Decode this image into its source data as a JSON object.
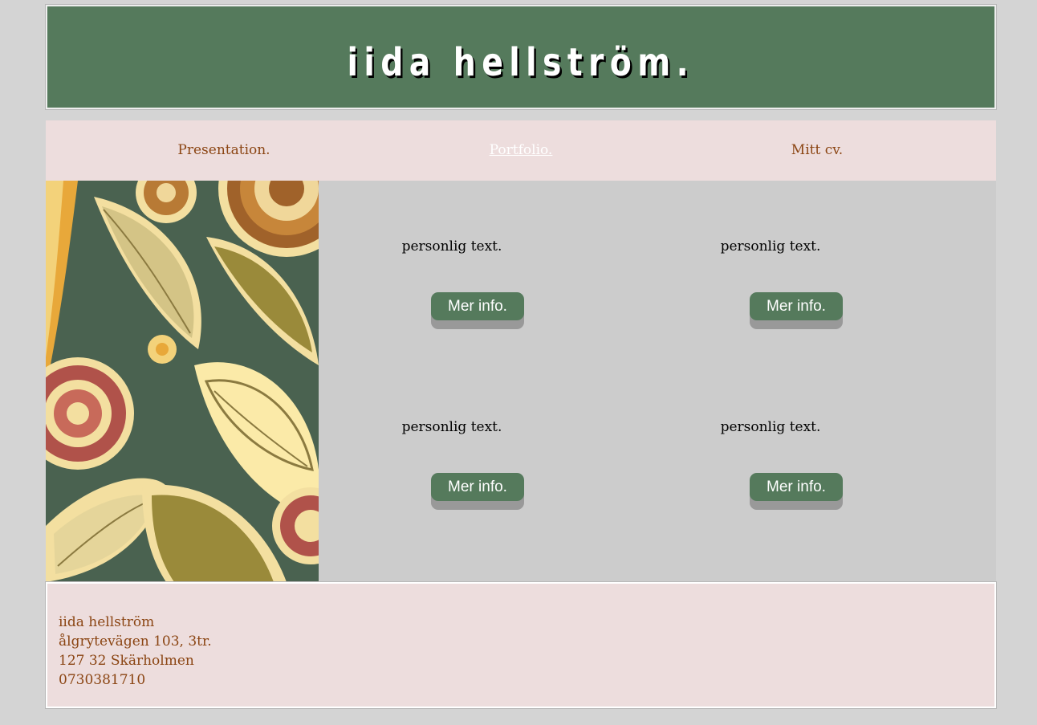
{
  "header": {
    "title": "iida hellström."
  },
  "nav": {
    "items": [
      {
        "label": "Presentation.",
        "active": false
      },
      {
        "label": "Portfolio.",
        "active": true
      },
      {
        "label": "Mitt cv.",
        "active": false
      }
    ]
  },
  "main": {
    "image": {
      "description_icon": "paisley-pattern-image"
    },
    "cards": [
      {
        "text": "personlig text.",
        "button_label": "Mer info."
      },
      {
        "text": "personlig text.",
        "button_label": "Mer info."
      },
      {
        "text": "personlig text.",
        "button_label": "Mer info."
      },
      {
        "text": "personlig text.",
        "button_label": "Mer info."
      }
    ]
  },
  "footer": {
    "name": "iida hellström",
    "street": "ålgrytevägen 103, 3tr.",
    "city": "127 32 Skärholmen",
    "phone": "0730381710"
  },
  "colors": {
    "page_background": "#d4d4d4",
    "header_green": "#557a5c",
    "nav_pink": "#eddddd",
    "link_brown": "#8b4513",
    "content_gray": "#cccccc",
    "button_shadow": "#999999"
  }
}
